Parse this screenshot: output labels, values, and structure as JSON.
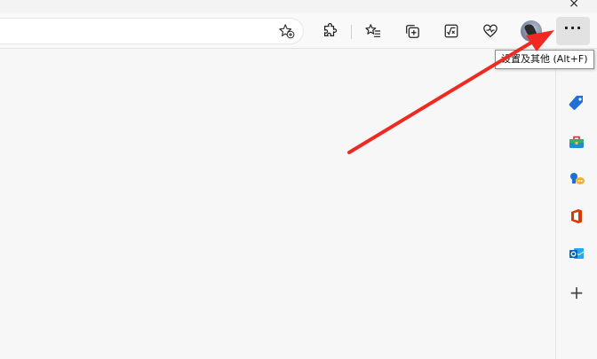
{
  "window": {
    "close_glyph": "×"
  },
  "toolbar": {
    "buttons": [
      {
        "name": "extensions-button",
        "icon": "puzzle-icon"
      },
      {
        "name": "favorites-button",
        "icon": "star-list-icon"
      },
      {
        "name": "collections-button",
        "icon": "collections-icon"
      },
      {
        "name": "math-solver-button",
        "icon": "math-solver-icon"
      },
      {
        "name": "performance-button",
        "icon": "heartbeat-icon"
      }
    ],
    "menu_label": "···",
    "menu_tooltip": "设置及其他 (Alt+F)"
  },
  "sidebar": {
    "items": [
      {
        "name": "sidebar-item-shopping",
        "icon": "tag-icon"
      },
      {
        "name": "sidebar-item-tools",
        "icon": "toolbox-icon"
      },
      {
        "name": "sidebar-item-games",
        "icon": "games-icon"
      },
      {
        "name": "sidebar-item-office",
        "icon": "office-icon"
      },
      {
        "name": "sidebar-item-outlook",
        "icon": "outlook-icon"
      }
    ],
    "add_label": "+"
  },
  "colors": {
    "arrow": "#ee2a22",
    "accent": "#0078d4"
  }
}
